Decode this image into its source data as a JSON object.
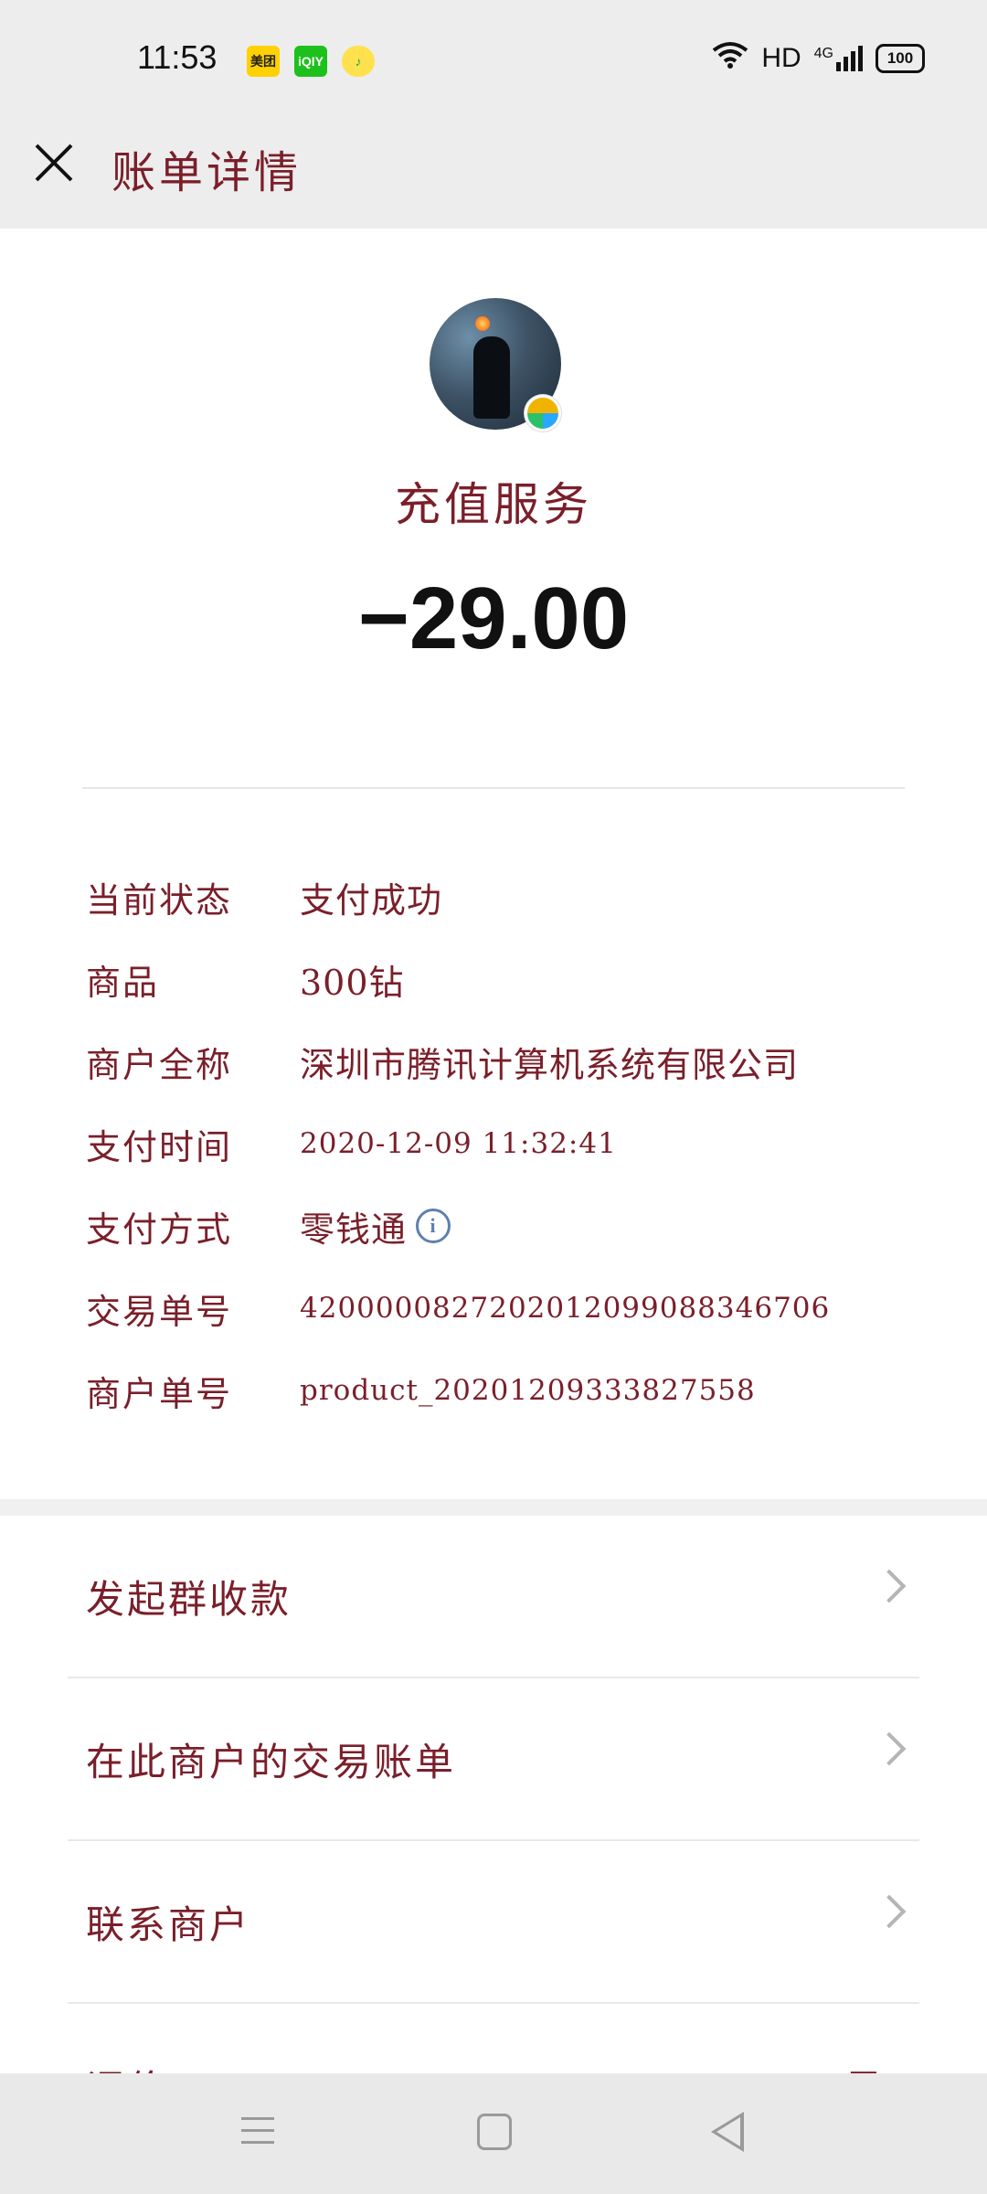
{
  "status_bar": {
    "time": "11:53",
    "apps": [
      {
        "name": "meituan-icon",
        "label": "美团"
      },
      {
        "name": "iqiyi-icon",
        "label": "iQIY"
      },
      {
        "name": "music-icon",
        "label": "♪"
      }
    ],
    "network": "HD",
    "signal": "4G",
    "battery": "100"
  },
  "header": {
    "close_icon": "close-icon",
    "title": "账单详情"
  },
  "merchant": {
    "name": "充值服务",
    "amount": "−29.00"
  },
  "details": [
    {
      "label": "当前状态",
      "value": "支付成功"
    },
    {
      "label": "商品",
      "value": "300钻"
    },
    {
      "label": "商户全称",
      "value": "深圳市腾讯计算机系统有限公司"
    },
    {
      "label": "支付时间",
      "value": "2020-12-09 11:32:41"
    },
    {
      "label": "支付方式",
      "value": "零钱通"
    },
    {
      "label": "交易单号",
      "value": "4200000827202012099088346706"
    },
    {
      "label": "商户单号",
      "value": "product_20201209333827558"
    }
  ],
  "actions": [
    {
      "label": "发起群收款"
    },
    {
      "label": "在此商户的交易账单"
    },
    {
      "label": "联系商户"
    }
  ],
  "partial_action": {
    "label": "评价",
    "right": "是"
  },
  "colors": {
    "accent_text": "#7a1f2a",
    "header_bg": "#ededed",
    "divider": "#e6e6e6",
    "info_blue": "#5f7fb0"
  }
}
